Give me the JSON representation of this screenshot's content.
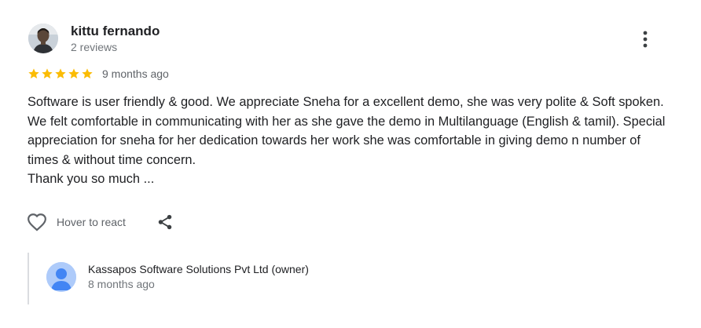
{
  "reviewer": {
    "name": "kittu fernando",
    "meta": "2 reviews",
    "avatar_icon": "user-photo-avatar"
  },
  "rating": {
    "stars": 5,
    "max": 5,
    "star_color": "#fbbc04",
    "time_ago": "9 months ago"
  },
  "review": {
    "text": "Software is user friendly & good. We appreciate Sneha for a excellent demo, she was very polite & Soft spoken. We felt comfortable in communicating with her as she gave the demo in Multilanguage (English & tamil). Special appreciation for sneha for her dedication towards her work she was comfortable in giving demo n number of times & without time concern.",
    "closing": "Thank you so much ..."
  },
  "actions": {
    "react_label": "Hover to react",
    "react_icon": "heart-outline-icon",
    "share_icon": "share-icon",
    "more_icon": "more-vertical-icon"
  },
  "owner_reply": {
    "name": "Kassapos Software Solutions Pvt Ltd (owner)",
    "time_ago": "8 months ago",
    "avatar_icon": "default-user-avatar",
    "avatar_color": "#aecbfa",
    "avatar_figure_color": "#4285f4"
  },
  "colors": {
    "text_primary": "#202124",
    "text_secondary": "#70757a",
    "icon_gray": "#5f6368",
    "divider": "#dadce0"
  }
}
